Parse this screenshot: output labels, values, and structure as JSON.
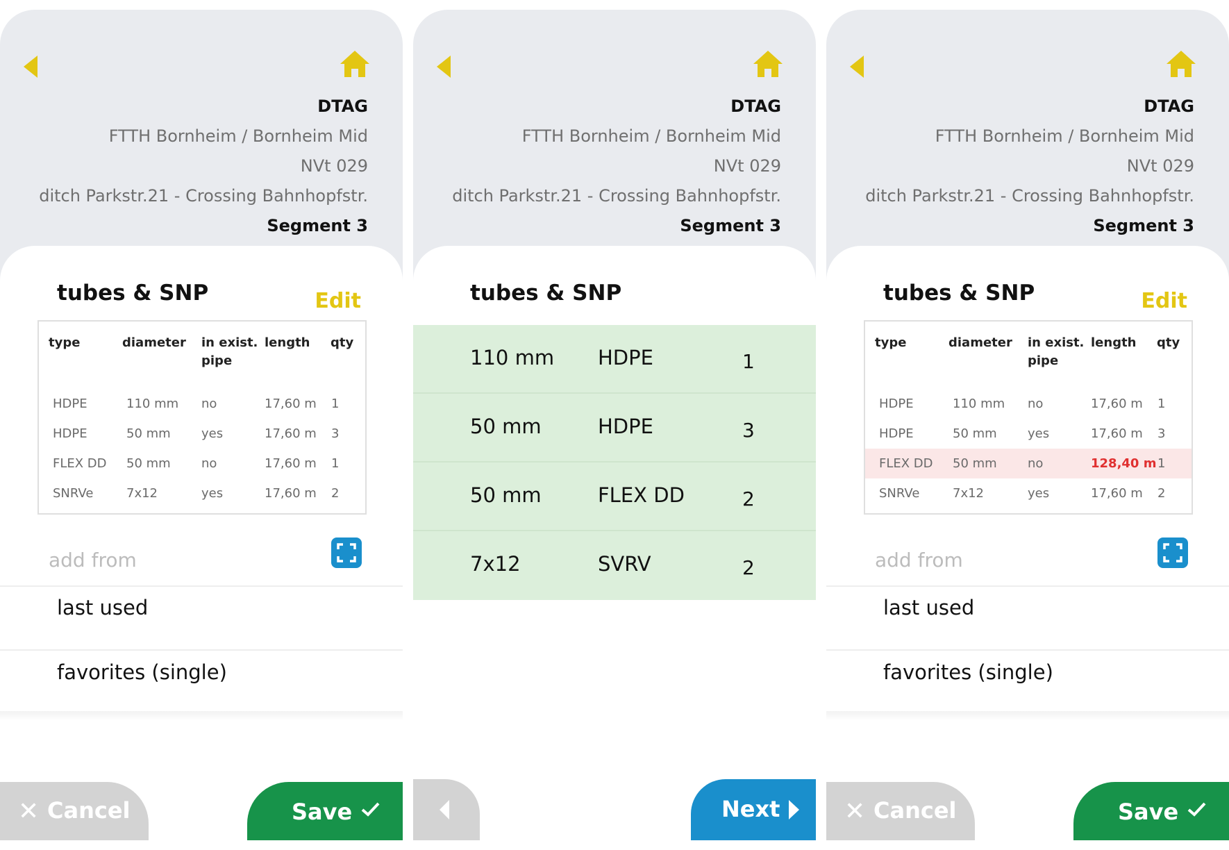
{
  "colors": {
    "accent_yellow": "#e3c613",
    "header_bg": "#e9ebef",
    "save_green": "#17934a",
    "next_blue": "#1a8fcc",
    "cancel_gray": "#d3d3d3",
    "alert_red": "#e03030",
    "list_green": "#dcefdb",
    "row_highlight": "#fbe7e7"
  },
  "icons": {
    "back": "back-arrow-icon",
    "home": "home-icon",
    "scan": "scan-icon",
    "close": "close-icon",
    "check": "check-icon",
    "next": "next-arrow-icon"
  },
  "header": {
    "company": "DTAG",
    "project": "FTTH Bornheim / Bornheim Mid",
    "nvt": "NVt 029",
    "ditch": "ditch Parkstr.21 - Crossing Bahnhopfstr.",
    "segment": "Segment 3"
  },
  "section": {
    "title": "tubes & SNP",
    "edit_label": "Edit"
  },
  "table": {
    "headers": {
      "type": "type",
      "diameter": "diameter",
      "in_exist_1": "in exist.",
      "in_exist_2": "pipe",
      "length": "length",
      "qty": "qty"
    },
    "rows": [
      {
        "type": "HDPE",
        "diameter": "110 mm",
        "in_exist": "no",
        "length": "17,60 m",
        "qty": "1"
      },
      {
        "type": "HDPE",
        "diameter": "50 mm",
        "in_exist": "yes",
        "length": "17,60 m",
        "qty": "3"
      },
      {
        "type": "FLEX DD",
        "diameter": "50 mm",
        "in_exist": "no",
        "length": "17,60 m",
        "qty": "1"
      },
      {
        "type": "SNRVe",
        "diameter": "7x12",
        "in_exist": "yes",
        "length": "17,60 m",
        "qty": "2"
      }
    ],
    "rows_edited": [
      {
        "type": "HDPE",
        "diameter": "110 mm",
        "in_exist": "no",
        "length": "17,60 m",
        "qty": "1"
      },
      {
        "type": "HDPE",
        "diameter": "50 mm",
        "in_exist": "yes",
        "length": "17,60 m",
        "qty": "3"
      },
      {
        "type": "FLEX DD",
        "diameter": "50 mm",
        "in_exist": "no",
        "length": "128,40 m",
        "qty": "1"
      },
      {
        "type": "SNRVe",
        "diameter": "7x12",
        "in_exist": "yes",
        "length": "17,60 m",
        "qty": "2"
      }
    ]
  },
  "add_from": {
    "label": "add from"
  },
  "lists": {
    "last_used": "last used",
    "favorites": "favorites (single)"
  },
  "buttons": {
    "cancel": "Cancel",
    "save": "Save",
    "next": "Next"
  },
  "selection": [
    {
      "diameter": "110 mm",
      "type": "HDPE",
      "qty": "1"
    },
    {
      "diameter": "50 mm",
      "type": "HDPE",
      "qty": "3"
    },
    {
      "diameter": "50 mm",
      "type": "FLEX DD",
      "qty": "2"
    },
    {
      "diameter": "7x12",
      "type": "SVRV",
      "qty": "2"
    }
  ]
}
